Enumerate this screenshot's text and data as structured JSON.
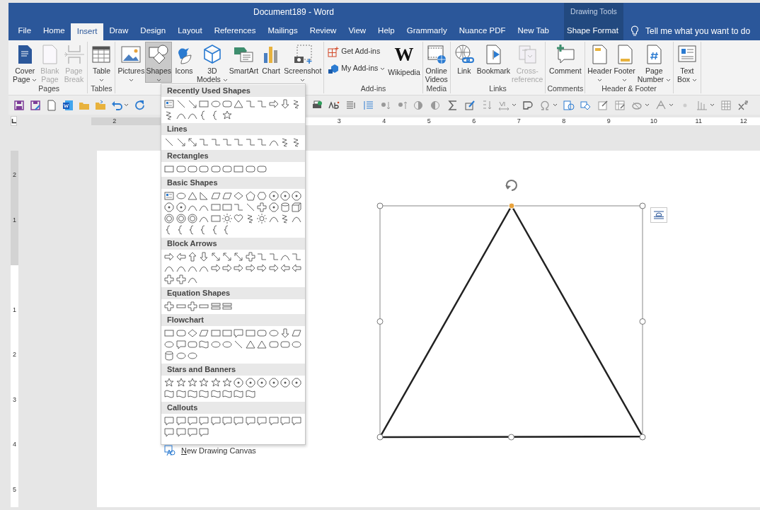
{
  "window": {
    "title": "Document189  -  Word"
  },
  "contextual_tab_group": {
    "title": "Drawing Tools"
  },
  "tabs": [
    {
      "label": "File",
      "selected": false,
      "kind": "standard"
    },
    {
      "label": "Home",
      "selected": false,
      "kind": "standard"
    },
    {
      "label": "Insert",
      "selected": true,
      "kind": "standard"
    },
    {
      "label": "Draw",
      "selected": false,
      "kind": "standard"
    },
    {
      "label": "Design",
      "selected": false,
      "kind": "standard"
    },
    {
      "label": "Layout",
      "selected": false,
      "kind": "standard"
    },
    {
      "label": "References",
      "selected": false,
      "kind": "standard"
    },
    {
      "label": "Mailings",
      "selected": false,
      "kind": "standard"
    },
    {
      "label": "Review",
      "selected": false,
      "kind": "standard"
    },
    {
      "label": "View",
      "selected": false,
      "kind": "standard"
    },
    {
      "label": "Help",
      "selected": false,
      "kind": "standard"
    },
    {
      "label": "Grammarly",
      "selected": false,
      "kind": "standard"
    },
    {
      "label": "Nuance PDF",
      "selected": false,
      "kind": "standard"
    },
    {
      "label": "New Tab",
      "selected": false,
      "kind": "standard"
    },
    {
      "label": "Shape Format",
      "selected": false,
      "kind": "contextual"
    }
  ],
  "tell_me": {
    "text": "Tell me what you want to do"
  },
  "ribbon": {
    "groups": [
      {
        "label": "Pages",
        "buttons": [
          {
            "kind": "large",
            "label": "Cover\nPage",
            "dropdown": true,
            "disabled": false,
            "expanded": false
          },
          {
            "kind": "large",
            "label": "Blank\nPage",
            "dropdown": false,
            "disabled": true,
            "expanded": false
          },
          {
            "kind": "large",
            "label": "Page\nBreak",
            "dropdown": false,
            "disabled": true,
            "expanded": false
          }
        ]
      },
      {
        "label": "Tables",
        "buttons": [
          {
            "kind": "large",
            "label": "Table",
            "dropdown": true,
            "disabled": false,
            "expanded": false
          }
        ]
      },
      {
        "buttons": [
          {
            "kind": "large",
            "label": "Pictures",
            "dropdown": true,
            "disabled": false,
            "expanded": false
          },
          {
            "kind": "large",
            "label": "Shapes",
            "dropdown": true,
            "disabled": false,
            "expanded": true
          },
          {
            "kind": "large",
            "label": "Icons",
            "dropdown": false,
            "disabled": false,
            "expanded": false
          },
          {
            "kind": "large",
            "label": "3D\nModels",
            "dropdown": true,
            "disabled": false,
            "expanded": false
          },
          {
            "kind": "large",
            "label": "SmartArt",
            "dropdown": false,
            "disabled": false,
            "expanded": false
          },
          {
            "kind": "large",
            "label": "Chart",
            "dropdown": false,
            "disabled": false,
            "expanded": false
          },
          {
            "kind": "large",
            "label": "Screenshot",
            "dropdown": true,
            "disabled": false,
            "expanded": false
          }
        ]
      },
      {
        "label": "Add-ins",
        "buttons": [
          {
            "kind": "small",
            "label": "Get Add-ins",
            "dropdown": false,
            "disabled": false,
            "expanded": false
          },
          {
            "kind": "small",
            "label": "My Add-ins",
            "dropdown": true,
            "disabled": false,
            "expanded": false
          },
          {
            "kind": "large",
            "label": "Wikipedia",
            "logo": "W",
            "dropdown": false,
            "disabled": false,
            "expanded": false
          }
        ]
      },
      {
        "label": "Media",
        "buttons": [
          {
            "kind": "large",
            "label": "Online\nVideos",
            "dropdown": false,
            "disabled": false,
            "expanded": false
          }
        ]
      },
      {
        "label": "Links",
        "buttons": [
          {
            "kind": "large",
            "label": "Link",
            "dropdown": false,
            "disabled": false,
            "expanded": false
          },
          {
            "kind": "large",
            "label": "Bookmark",
            "dropdown": false,
            "disabled": false,
            "expanded": false
          },
          {
            "kind": "large",
            "label": "Cross-\nreference",
            "dropdown": false,
            "disabled": true,
            "expanded": false
          }
        ]
      },
      {
        "label": "Comments",
        "buttons": [
          {
            "kind": "large",
            "label": "Comment",
            "dropdown": false,
            "disabled": false,
            "expanded": false
          }
        ]
      },
      {
        "label": "Header & Footer",
        "buttons": [
          {
            "kind": "large",
            "label": "Header",
            "dropdown": true,
            "disabled": false,
            "expanded": false
          },
          {
            "kind": "large",
            "label": "Footer",
            "dropdown": true,
            "disabled": false,
            "expanded": false
          },
          {
            "kind": "large",
            "label": "Page\nNumber",
            "dropdown": true,
            "disabled": false,
            "expanded": false
          }
        ]
      },
      {
        "buttons": [
          {
            "kind": "large",
            "label": "Text\nBox",
            "dropdown": true,
            "disabled": false,
            "expanded": false
          }
        ]
      }
    ]
  },
  "horizontal_ruler": {
    "left_labels": [
      "2"
    ],
    "labels": [
      "3",
      "4",
      "5",
      "6",
      "7",
      "8",
      "9",
      "10",
      "11",
      "12"
    ]
  },
  "vertical_ruler": {
    "top_labels": [
      "2",
      "1"
    ],
    "labels": [
      "1",
      "2",
      "3",
      "4",
      "5"
    ]
  },
  "document": {
    "shape": {
      "kind": "triangle",
      "selected": true
    }
  },
  "shapes_menu": {
    "sections": [
      {
        "title": "Recently Used Shapes"
      },
      {
        "title": "Lines"
      },
      {
        "title": "Rectangles"
      },
      {
        "title": "Basic Shapes"
      },
      {
        "title": "Block Arrows"
      },
      {
        "title": "Equation Shapes"
      },
      {
        "title": "Flowchart"
      },
      {
        "title": "Stars and Banners"
      },
      {
        "title": "Callouts"
      }
    ],
    "footer": {
      "label": "New Drawing Canvas"
    }
  }
}
